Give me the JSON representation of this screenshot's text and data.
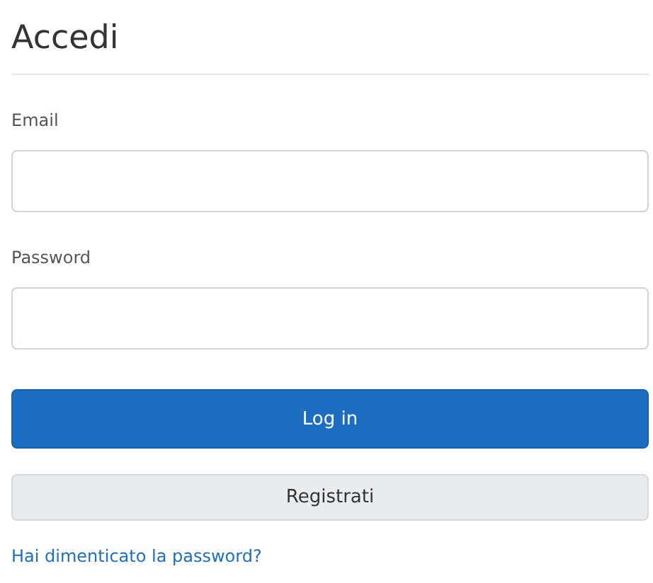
{
  "title": "Accedi",
  "fields": [
    {
      "label": "Email"
    },
    {
      "label": "Password"
    }
  ],
  "buttons": [
    {
      "label": "Log in",
      "kind": "primary"
    },
    {
      "label": "Registrati",
      "kind": "secondary"
    }
  ],
  "link": "Hai dimenticato la password?"
}
